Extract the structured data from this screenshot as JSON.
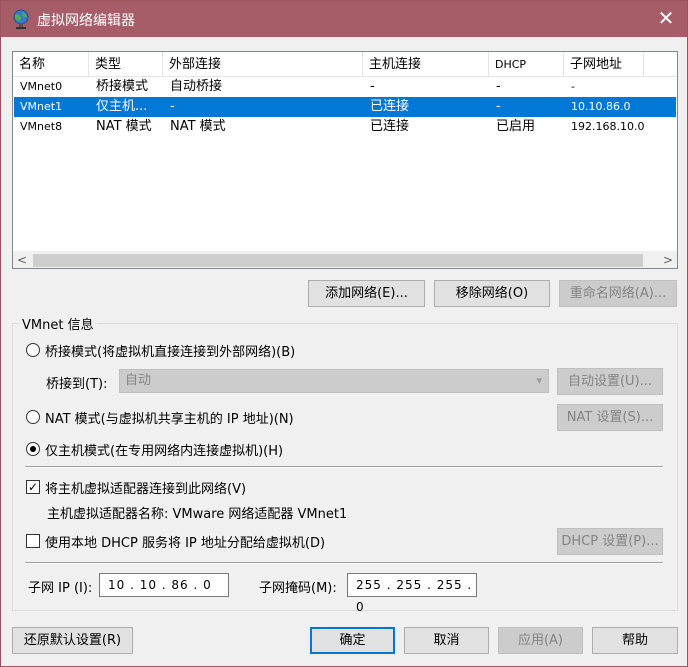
{
  "window": {
    "title": "虚拟网络编辑器",
    "close_glyph": "✕"
  },
  "table": {
    "headers": [
      "名称",
      "类型",
      "外部连接",
      "主机连接",
      "DHCP",
      "子网地址"
    ],
    "rows": [
      {
        "name": "VMnet0",
        "type": "桥接模式",
        "external": "自动桥接",
        "host": "-",
        "dhcp": "-",
        "subnet": "-"
      },
      {
        "name": "VMnet1",
        "type": "仅主机...",
        "external": "-",
        "host": "已连接",
        "dhcp": "-",
        "subnet": "10.10.86.0"
      },
      {
        "name": "VMnet8",
        "type": "NAT 模式",
        "external": "NAT 模式",
        "host": "已连接",
        "dhcp": "已启用",
        "subnet": "192.168.10.0"
      }
    ],
    "selected_row": 1,
    "scroll_left": "<",
    "scroll_right": ">"
  },
  "buttons": {
    "add_network": "添加网络(E)...",
    "remove_network": "移除网络(O)",
    "rename_network": "重命名网络(A)...",
    "auto_settings": "自动设置(U)...",
    "nat_settings": "NAT 设置(S)...",
    "dhcp_settings": "DHCP 设置(P)...",
    "restore_defaults": "还原默认设置(R)",
    "ok": "确定",
    "cancel": "取消",
    "apply": "应用(A)",
    "help": "帮助"
  },
  "vmnet_info": {
    "title": "VMnet 信息",
    "bridged_label": "桥接模式(将虚拟机直接连接到外部网络)(B)",
    "bridged_to_label": "桥接到(T):",
    "bridged_to_value": "自动",
    "nat_label": "NAT 模式(与虚拟机共享主机的 IP 地址)(N)",
    "hostonly_label": "仅主机模式(在专用网络内连接虚拟机)(H)",
    "selected_mode": "hostonly",
    "connect_adapter_label": "将主机虚拟适配器连接到此网络(V)",
    "connect_adapter_checked": true,
    "adapter_name_label": "主机虚拟适配器名称: VMware 网络适配器 VMnet1",
    "use_dhcp_label": "使用本地 DHCP 服务将 IP 地址分配给虚拟机(D)",
    "use_dhcp_checked": false,
    "subnet_ip_label": "子网 IP (I):",
    "subnet_ip_value": "10 . 10 . 86 . 0",
    "subnet_mask_label": "子网掩码(M):",
    "subnet_mask_value": "255 . 255 . 255 . 0",
    "check_glyph": "✓",
    "dropdown_glyph": "▾"
  },
  "colors": {
    "titlebar": "#a65d68",
    "selection": "#0078d7"
  }
}
